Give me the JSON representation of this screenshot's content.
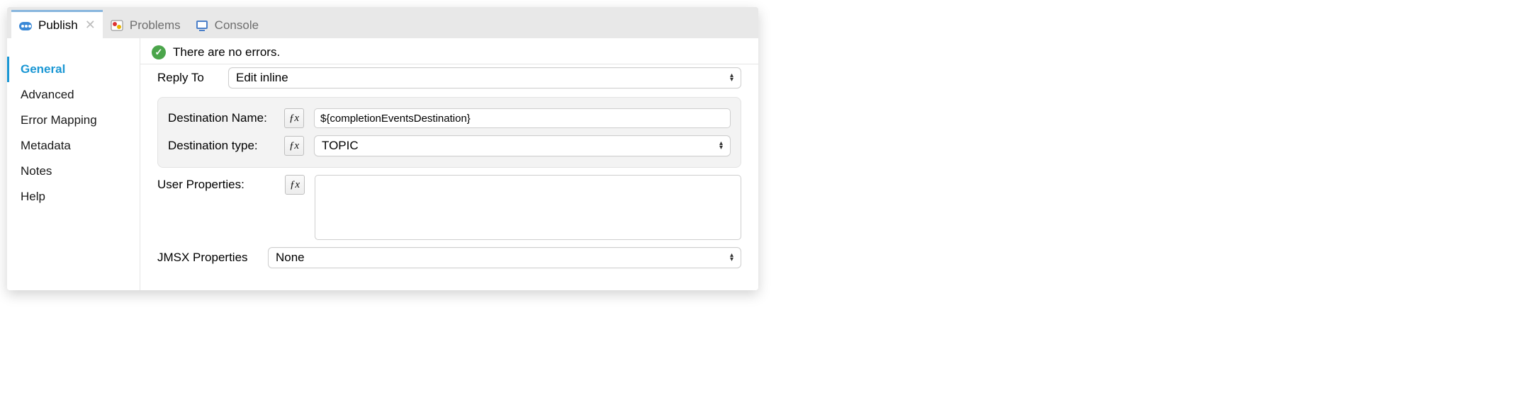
{
  "tabs": {
    "publish": {
      "label": "Publish"
    },
    "problems": {
      "label": "Problems"
    },
    "console": {
      "label": "Console"
    }
  },
  "sidebar": {
    "items": {
      "general": {
        "label": "General"
      },
      "advanced": {
        "label": "Advanced"
      },
      "error_mapping": {
        "label": "Error Mapping"
      },
      "metadata": {
        "label": "Metadata"
      },
      "notes": {
        "label": "Notes"
      },
      "help": {
        "label": "Help"
      }
    }
  },
  "status": {
    "message": "There are no errors."
  },
  "form": {
    "reply_to": {
      "label": "Reply To",
      "value": "Edit inline"
    },
    "destination_name": {
      "label": "Destination Name:",
      "value": "${completionEventsDestination}"
    },
    "destination_type": {
      "label": "Destination type:",
      "value": "TOPIC"
    },
    "user_properties": {
      "label": "User Properties:",
      "value": ""
    },
    "jmsx_properties": {
      "label": "JMSX Properties",
      "value": "None"
    },
    "fx_label": "ƒx"
  }
}
